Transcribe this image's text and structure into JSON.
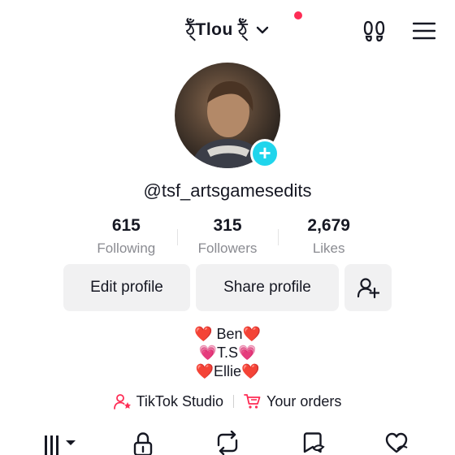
{
  "header": {
    "title": "ঠ্ঁTlou ঠ্ঁ",
    "notification_dot": true
  },
  "profile": {
    "username": "@tsf_artsgamesedits",
    "stats": [
      {
        "value": "615",
        "label": "Following"
      },
      {
        "value": "315",
        "label": "Followers"
      },
      {
        "value": "2,679",
        "label": "Likes"
      }
    ]
  },
  "actions": {
    "edit_label": "Edit profile",
    "share_label": "Share profile"
  },
  "bio": {
    "lines": [
      "❤️ Ben❤️",
      "💗T.S💗",
      "❤️Ellie❤️"
    ]
  },
  "links": {
    "studio": "TikTok Studio",
    "orders": "Your orders"
  },
  "colors": {
    "accent_red": "#fe2c55",
    "teal": "#20d5ec",
    "button_bg": "#f1f1f2"
  },
  "icons": [
    "footprints-icon",
    "menu-icon",
    "add-friend-icon",
    "tiktok-studio-icon",
    "cart-icon",
    "grid-icon",
    "lock-icon",
    "repost-icon",
    "favorites-icon",
    "liked-icon"
  ]
}
